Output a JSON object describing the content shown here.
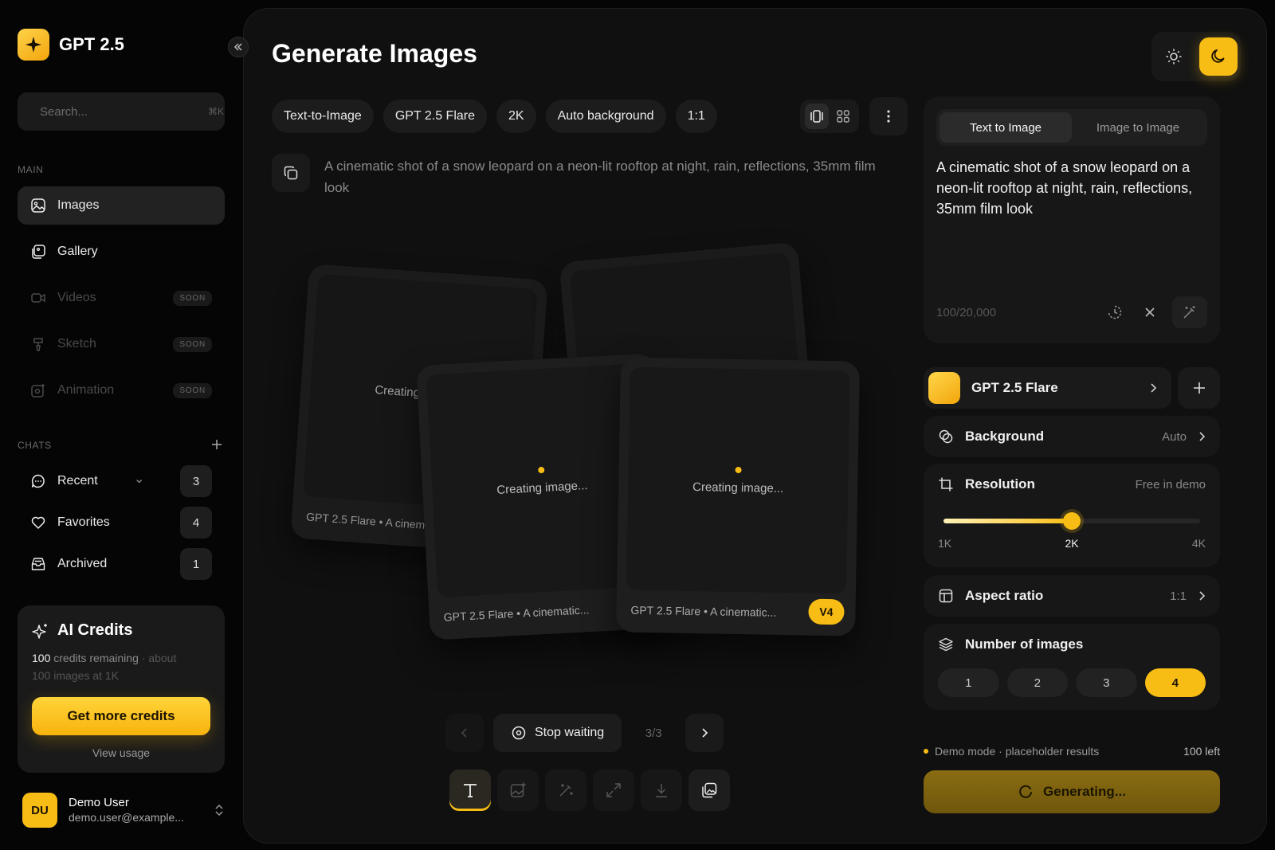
{
  "brand": {
    "name": "GPT 2.5"
  },
  "search": {
    "placeholder": "Search...",
    "shortcut": "⌘K"
  },
  "sidebar": {
    "main_label": "MAIN",
    "items": [
      {
        "label": "Images",
        "badge": ""
      },
      {
        "label": "Gallery",
        "badge": ""
      },
      {
        "label": "Videos",
        "badge": "SOON"
      },
      {
        "label": "Sketch",
        "badge": "SOON"
      },
      {
        "label": "Animation",
        "badge": "SOON"
      }
    ],
    "chats_label": "CHATS",
    "chats": [
      {
        "label": "Recent",
        "count": "3"
      },
      {
        "label": "Favorites",
        "count": "4"
      },
      {
        "label": "Archived",
        "count": "1"
      }
    ]
  },
  "credits": {
    "title": "AI Credits",
    "amount": "100",
    "remaining_text": " credits remaining",
    "about_text": " · about",
    "detail": "100 images at 1K",
    "button": "Get more credits",
    "view_usage": "View usage"
  },
  "user": {
    "initials": "DU",
    "name": "Demo User",
    "email": "demo.user@example..."
  },
  "main": {
    "title": "Generate Images",
    "chips": [
      "Text-to-Image",
      "GPT 2.5 Flare",
      "2K",
      "Auto background",
      "1:1"
    ],
    "prompt": "A cinematic shot of a snow leopard on a neon-lit rooftop at night, rain, reflections, 35mm film look",
    "cards": [
      {
        "status": "Creating image...",
        "caption": "GPT 2.5 Flare • A cinematic...",
        "badge": ""
      },
      {
        "status": "",
        "caption": "",
        "badge": ""
      },
      {
        "status": "Creating image...",
        "caption": "GPT 2.5 Flare • A cinematic...",
        "badge": ""
      },
      {
        "status": "Creating image...",
        "caption": "GPT 2.5 Flare • A cinematic...",
        "badge": "V4"
      }
    ],
    "pager": {
      "stop_label": "Stop waiting",
      "count": "3/3"
    }
  },
  "panel": {
    "tabs": [
      "Text to Image",
      "Image to Image"
    ],
    "prompt_value": "A cinematic shot of a snow leopard on a neon-lit rooftop at night, rain, reflections, 35mm film look",
    "char_count": "100/20,000",
    "model": "GPT 2.5 Flare",
    "background": {
      "label": "Background",
      "value": "Auto"
    },
    "resolution": {
      "label": "Resolution",
      "note": "Free in demo",
      "options": [
        "1K",
        "2K",
        "4K"
      ],
      "selected": "2K",
      "level": 0.5
    },
    "aspect": {
      "label": "Aspect ratio",
      "value": "1:1"
    },
    "num_images": {
      "label": "Number of images",
      "options": [
        "1",
        "2",
        "3",
        "4"
      ],
      "selected": "4"
    },
    "demo": {
      "text": "Demo mode · placeholder results",
      "left": "100 left"
    },
    "generate_label": "Generating..."
  },
  "colors": {
    "accent": "#f8bd14",
    "background": "#050505",
    "panel": "#101010"
  }
}
